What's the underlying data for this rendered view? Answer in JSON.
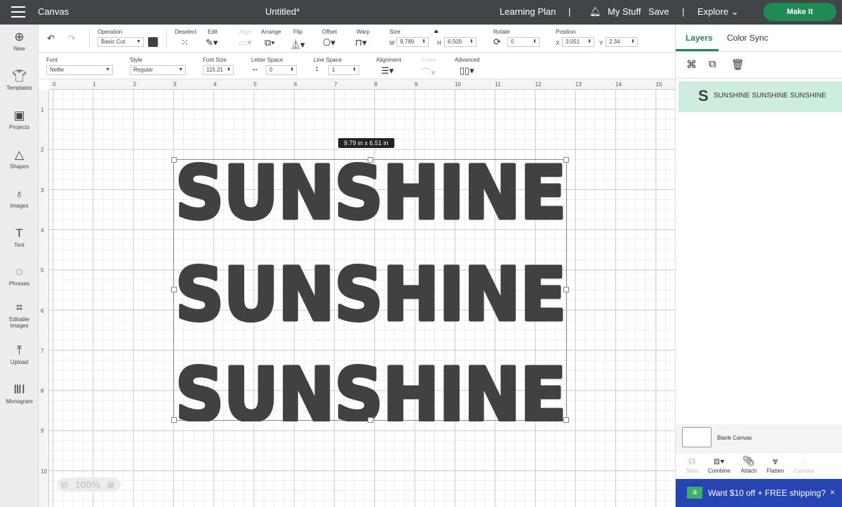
{
  "topbar": {
    "app": "Canvas",
    "title": "Untitled*",
    "learning": "Learning Plan",
    "mystuff": "My Stuff",
    "save": "Save",
    "explore": "Explore",
    "makeit": "Make It"
  },
  "sidebar": [
    {
      "label": "New",
      "icon": "plus-icon"
    },
    {
      "label": "Templates",
      "icon": "shirt-icon"
    },
    {
      "label": "Projects",
      "icon": "projects-icon"
    },
    {
      "label": "Shapes",
      "icon": "shapes-icon"
    },
    {
      "label": "Images",
      "icon": "lightbulb-icon"
    },
    {
      "label": "Text",
      "icon": "text-icon"
    },
    {
      "label": "Phrases",
      "icon": "speech-icon"
    },
    {
      "label": "Editable Images",
      "icon": "editable-images-icon"
    },
    {
      "label": "Upload",
      "icon": "upload-icon"
    },
    {
      "label": "Monogram",
      "icon": "monogram-icon"
    }
  ],
  "toolbar1": {
    "operation_label": "Operation",
    "operation": "Basic Cut",
    "op_color": "#414141",
    "deselect": "Deselect",
    "edit": "Edit",
    "align": "Align",
    "arrange": "Arrange",
    "flip": "Flip",
    "offset": "Offset",
    "warp": "Warp",
    "size": "Size",
    "w_label": "W",
    "w": "9.789",
    "h_label": "H",
    "h": "6.509",
    "rotate": "Rotate",
    "rotate_value": "0",
    "position": "Position",
    "x_label": "X",
    "x": "3.051",
    "y_label": "Y",
    "y": "2.34"
  },
  "toolbar2": {
    "font_label": "Font",
    "font": "Nellie",
    "style_label": "Style",
    "style": "Regular",
    "fontsize_label": "Font Size",
    "fontsize": "115.21",
    "letter_label": "Letter Space",
    "letter": "0",
    "line_label": "Line Space",
    "line": "1",
    "alignment": "Alignment",
    "curve": "Curve",
    "advanced": "Advanced"
  },
  "ruler": {
    "h": [
      "0",
      "1",
      "2",
      "3",
      "4",
      "5",
      "6",
      "7",
      "8",
      "9",
      "10",
      "11",
      "12",
      "13",
      "14",
      "15"
    ],
    "v": [
      "1",
      "2",
      "3",
      "4",
      "5",
      "6",
      "7",
      "8",
      "9",
      "10"
    ]
  },
  "canvas": {
    "size_tooltip": "9.79  in x 6.51  in",
    "lines": [
      "SUNSHINE",
      "SUNSHINE",
      "SUNSHINE"
    ],
    "text_color": "#414141",
    "zoom": "100%"
  },
  "panel": {
    "tabs": [
      "Layers",
      "Color Sync"
    ],
    "layer_name": "SUNSHINE SUNSHINE SUNSHINE",
    "layer_icon": "S",
    "blank_canvas": "Blank Canvas",
    "actions": [
      {
        "label": "Slice",
        "icon": "slice-icon",
        "enabled": false
      },
      {
        "label": "Combine",
        "icon": "combine-icon",
        "enabled": true
      },
      {
        "label": "Attach",
        "icon": "attach-icon",
        "enabled": true
      },
      {
        "label": "Flatten",
        "icon": "flatten-icon",
        "enabled": true
      },
      {
        "label": "Contour",
        "icon": "contour-icon",
        "enabled": false
      }
    ],
    "promo": "Want $10 off + FREE shipping?",
    "accent": "#1f8a53"
  }
}
